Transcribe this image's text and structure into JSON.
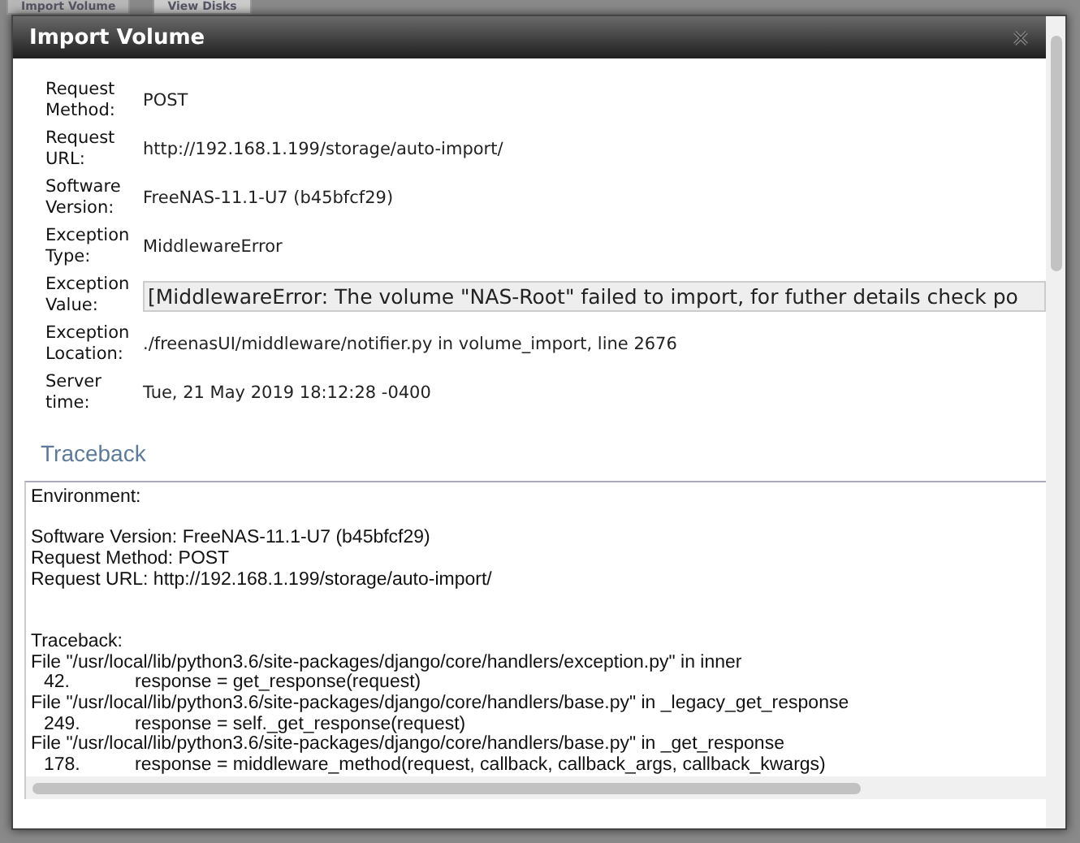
{
  "tabs": [
    {
      "label": "Import Volume",
      "selected": true
    },
    {
      "label": "View Disks",
      "selected": false
    }
  ],
  "dialog": {
    "title": "Import Volume",
    "details": [
      {
        "label": "Request Method:",
        "value": "POST",
        "kind": "text"
      },
      {
        "label": "Request URL:",
        "value": "http://192.168.1.199/storage/auto-import/",
        "kind": "text"
      },
      {
        "label": "Software Version:",
        "value": "FreeNAS-11.1-U7 (b45bfcf29)",
        "kind": "text"
      },
      {
        "label": "Exception Type:",
        "value": "MiddlewareError",
        "kind": "text"
      },
      {
        "label": "Exception Value:",
        "value": "[MiddlewareError: The volume \"NAS-Root\" failed to import, for futher details check po",
        "kind": "pre"
      },
      {
        "label": "Exception Location:",
        "value": "./freenasUI/middleware/notifier.py in volume_import, line 2676",
        "kind": "text"
      },
      {
        "label": "Server time:",
        "value": "Tue, 21 May 2019 18:12:28 -0400",
        "kind": "text"
      }
    ],
    "traceback_heading": "Traceback",
    "traceback": {
      "environment_label": "Environment:",
      "environment": [
        "Software Version: FreeNAS-11.1-U7 (b45bfcf29)",
        "Request Method: POST",
        "Request URL: http://192.168.1.199/storage/auto-import/"
      ],
      "traceback_label": "Traceback:",
      "frames": [
        {
          "file": "File \"/usr/local/lib/python3.6/site-packages/django/core/handlers/exception.py\" in inner",
          "line_no": "42.",
          "code": "response = get_response(request)"
        },
        {
          "file": "File \"/usr/local/lib/python3.6/site-packages/django/core/handlers/base.py\" in _legacy_get_response",
          "line_no": "249.",
          "code": "response = self._get_response(request)"
        },
        {
          "file": "File \"/usr/local/lib/python3.6/site-packages/django/core/handlers/base.py\" in _get_response",
          "line_no": "178.",
          "code": "response = middleware_method(request, callback, callback_args, callback_kwargs)"
        }
      ]
    }
  }
}
